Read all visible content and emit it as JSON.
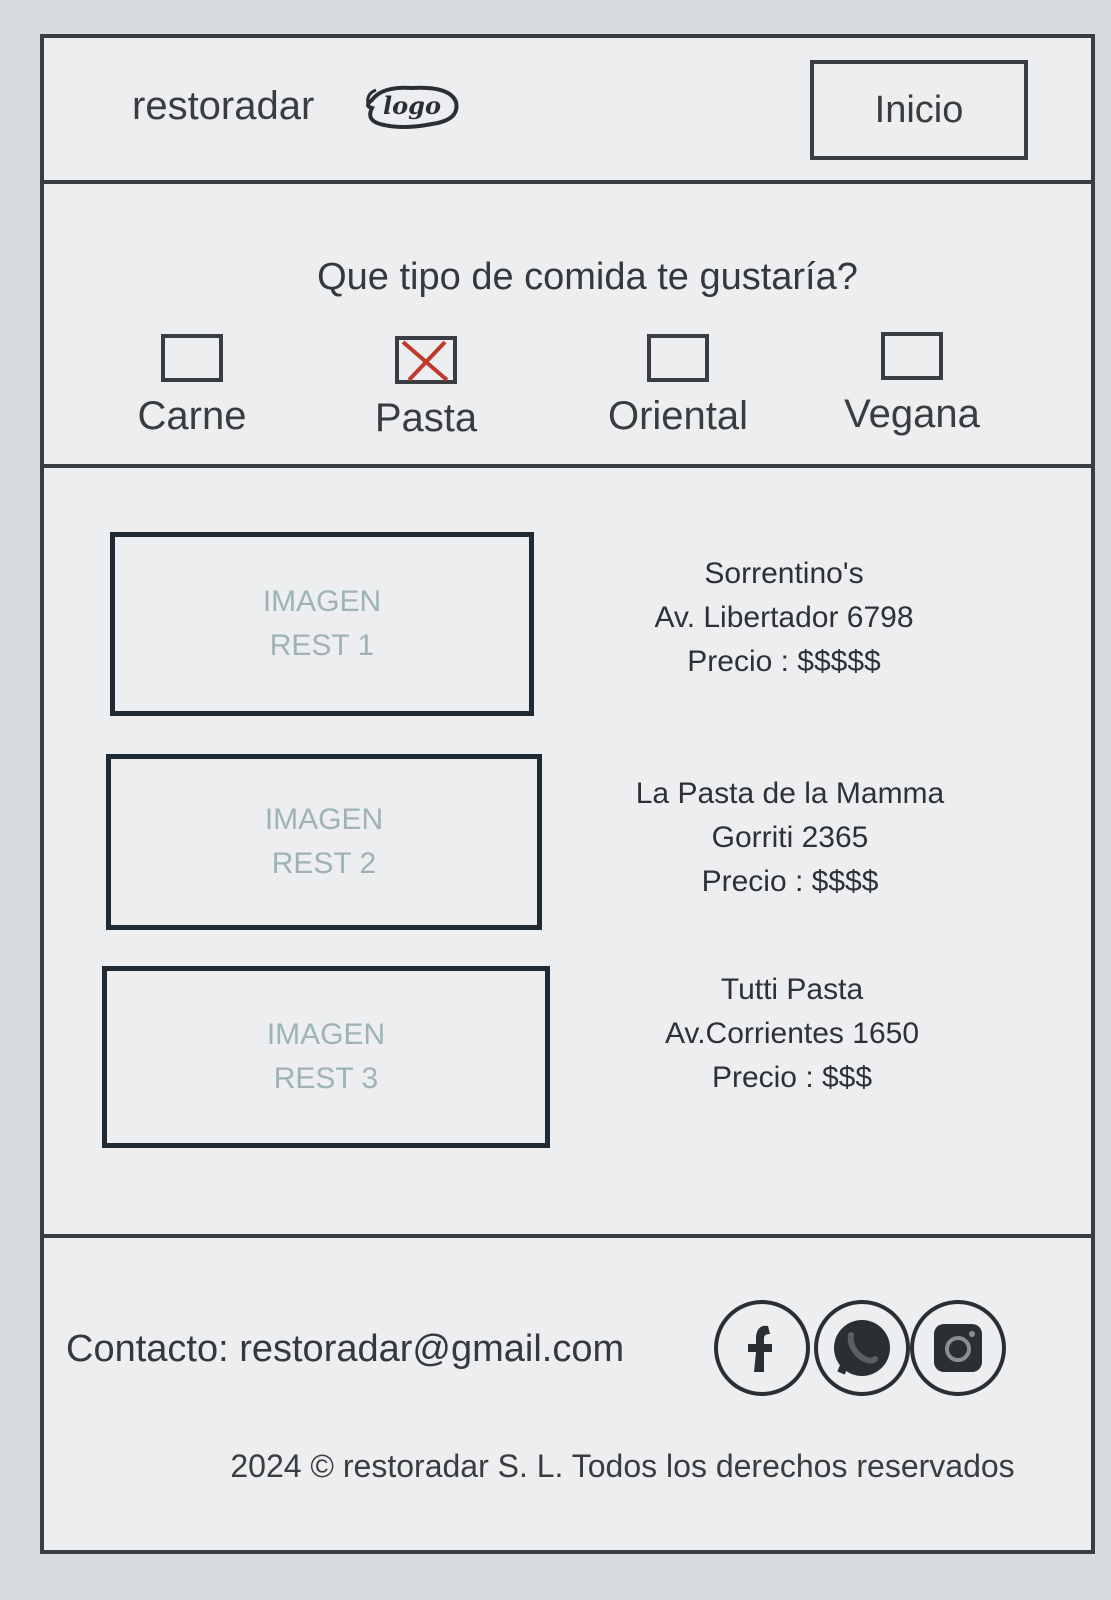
{
  "header": {
    "brand": "restoradar",
    "logo_text": "logo",
    "nav_button": "Inicio"
  },
  "filter": {
    "question": "Que tipo de comida te gustaría?",
    "options": [
      {
        "label": "Carne",
        "checked": false
      },
      {
        "label": "Pasta",
        "checked": true
      },
      {
        "label": "Oriental",
        "checked": false
      },
      {
        "label": "Vegana",
        "checked": false
      }
    ]
  },
  "restaurants": [
    {
      "image_line1": "IMAGEN",
      "image_line2": "REST 1",
      "name": "Sorrentino's",
      "address": "Av. Libertador 6798",
      "price": "Precio : $$$$$"
    },
    {
      "image_line1": "IMAGEN",
      "image_line2": "REST 2",
      "name": "La Pasta de la Mamma",
      "address": "Gorriti 2365",
      "price": "Precio : $$$$"
    },
    {
      "image_line1": "IMAGEN",
      "image_line2": "REST 3",
      "name": "Tutti Pasta",
      "address": "Av.Corrientes 1650",
      "price": "Precio : $$$"
    }
  ],
  "footer": {
    "contact": "Contacto: restoradar@gmail.com",
    "social_icons": [
      "facebook-icon",
      "whatsapp-icon",
      "instagram-icon"
    ],
    "copyright": "2024 © restoradar S. L. Todos los derechos reservados"
  },
  "colors": {
    "ink": "#3a3e42",
    "image_placeholder_text": "#9fb3b7",
    "check_mark": "#c0392b"
  }
}
